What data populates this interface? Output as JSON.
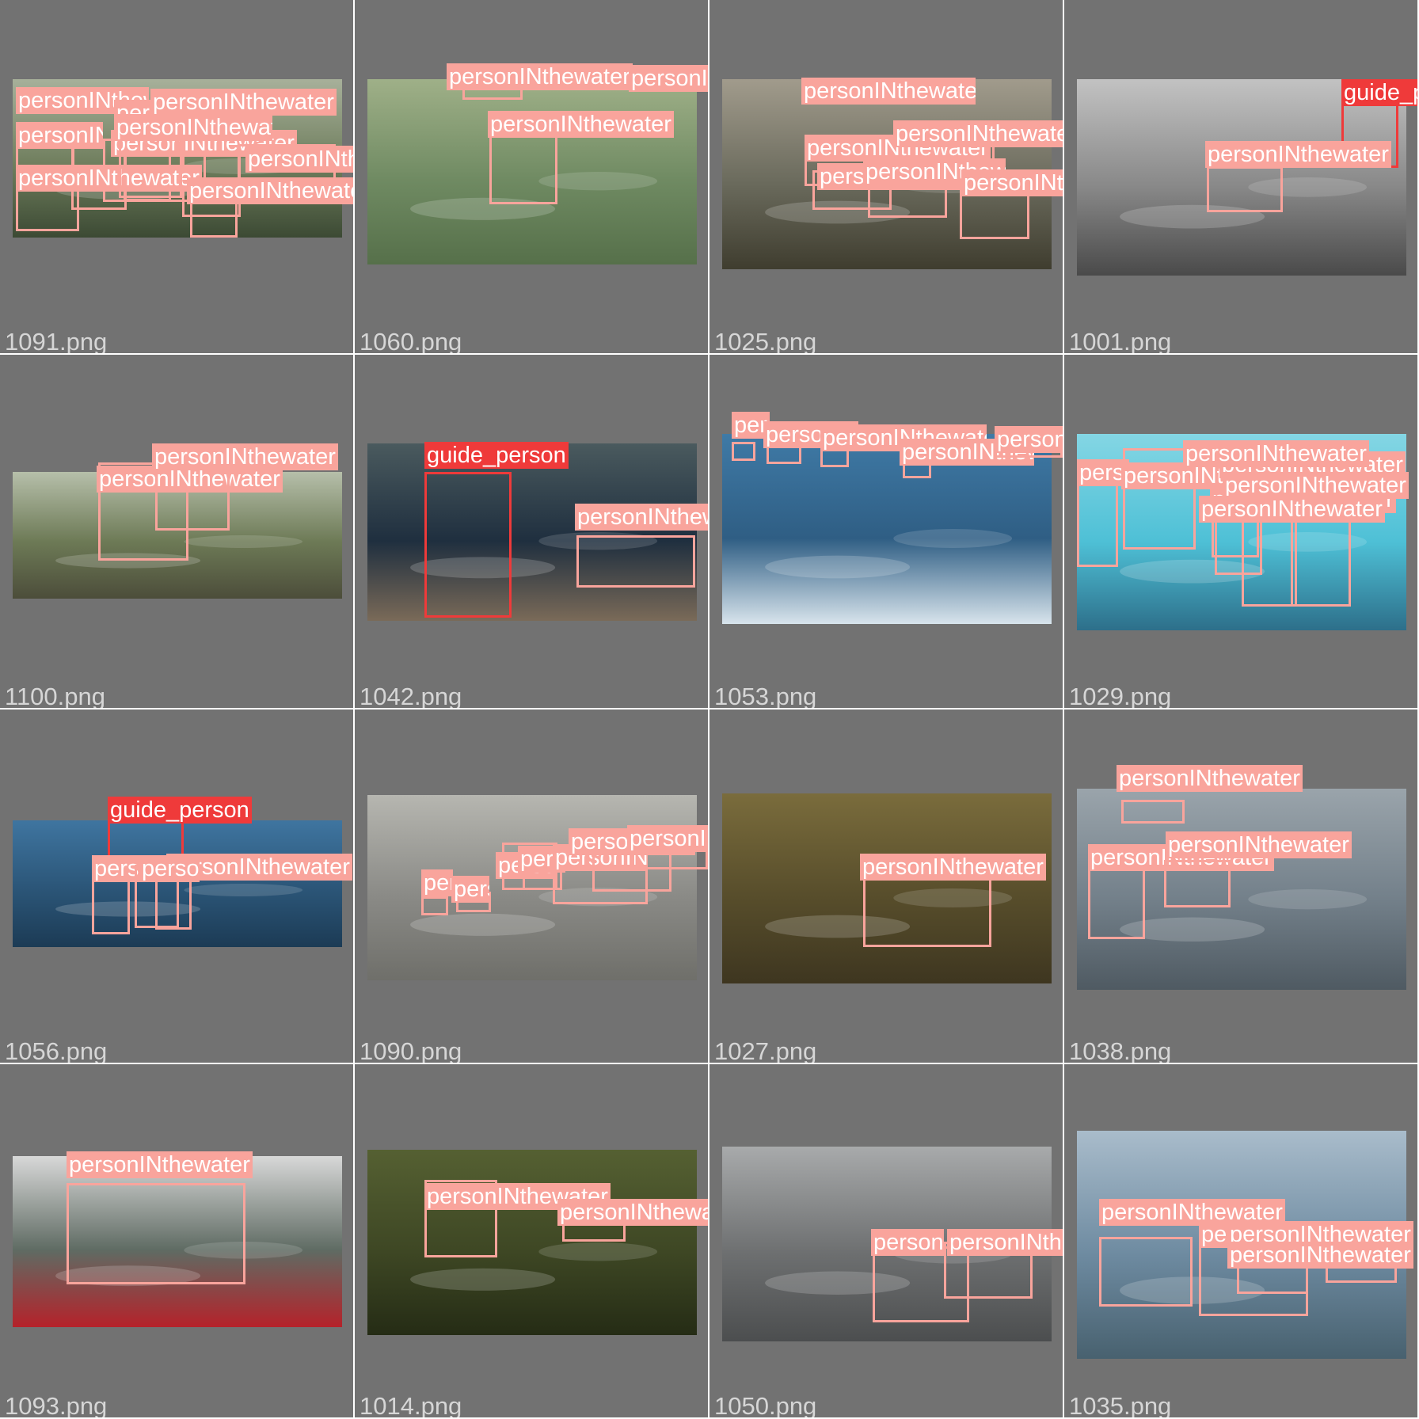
{
  "colors": {
    "tile_background": "#727272",
    "separator": "#ffffff",
    "personINthewater": "#f9a49c",
    "guide_person": "#ef3a3a",
    "filename_text": "#d6d6d6"
  },
  "tiles": [
    {
      "filename": "1091.png",
      "labels": [
        {
          "cls": "personINthewater",
          "text": "personINthewater"
        },
        {
          "cls": "personINthewater",
          "text": "personINthewater"
        },
        {
          "cls": "personINthewater",
          "text": "personINthewater"
        },
        {
          "cls": "personINthewater",
          "text": "personINthewater"
        },
        {
          "cls": "personINthewater",
          "text": "personINthewater"
        },
        {
          "cls": "personINthewater",
          "text": "personINthewater"
        },
        {
          "cls": "personINthewater",
          "text": "personINthewater"
        },
        {
          "cls": "personINthewater",
          "text": "personINthewater"
        },
        {
          "cls": "personINthewater",
          "text": "personINthewater"
        }
      ]
    },
    {
      "filename": "1060.png",
      "labels": [
        {
          "cls": "personINthewater",
          "text": "personINthewater"
        },
        {
          "cls": "personINthewater",
          "text": "personINthewater"
        },
        {
          "cls": "personINthewater",
          "text": "personINthewater"
        }
      ]
    },
    {
      "filename": "1025.png",
      "labels": [
        {
          "cls": "personINthewater",
          "text": "personINthewater"
        },
        {
          "cls": "personINthewater",
          "text": "personINthewater"
        },
        {
          "cls": "personINthewater",
          "text": "personINthewater"
        },
        {
          "cls": "personINthewater",
          "text": "personINthewater"
        },
        {
          "cls": "personINthewater",
          "text": "personINthewater"
        },
        {
          "cls": "personINthewater",
          "text": "personINthewater"
        }
      ]
    },
    {
      "filename": "1001.png",
      "labels": [
        {
          "cls": "guide_person",
          "text": "guide_person"
        },
        {
          "cls": "personINthewater",
          "text": "personINthewater"
        }
      ]
    },
    {
      "filename": "1100.png",
      "labels": [
        {
          "cls": "personINthewater",
          "text": "personINthewater"
        },
        {
          "cls": "personINthewater",
          "text": "personINthewater"
        }
      ]
    },
    {
      "filename": "1042.png",
      "labels": [
        {
          "cls": "guide_person",
          "text": "guide_person"
        },
        {
          "cls": "personINthewater",
          "text": "personINthewater"
        }
      ]
    },
    {
      "filename": "1053.png",
      "labels": [
        {
          "cls": "personINthewater",
          "text": "personINthewater"
        },
        {
          "cls": "personINthewater",
          "text": "personINthewater"
        },
        {
          "cls": "personINthewater",
          "text": "personINthewater"
        },
        {
          "cls": "personINthewater",
          "text": "personINthewater"
        },
        {
          "cls": "personINthewater",
          "text": "personINthewater"
        }
      ]
    },
    {
      "filename": "1029.png",
      "labels": [
        {
          "cls": "personINthewater",
          "text": "personINthewater"
        },
        {
          "cls": "personINthewater",
          "text": "personINthewater"
        },
        {
          "cls": "personINthewater",
          "text": "personINthewater"
        },
        {
          "cls": "personINthewater",
          "text": "personINthewater"
        },
        {
          "cls": "personINthewater",
          "text": "personINthewater"
        },
        {
          "cls": "personINthewater",
          "text": "personINthewater"
        },
        {
          "cls": "personINthewater",
          "text": "personINthewater"
        }
      ]
    },
    {
      "filename": "1056.png",
      "labels": [
        {
          "cls": "guide_person",
          "text": "guide_person"
        },
        {
          "cls": "personINthewater",
          "text": "personINthewater"
        },
        {
          "cls": "personINthewater",
          "text": "personINthewater"
        },
        {
          "cls": "personINthewater",
          "text": "personINthewater"
        }
      ]
    },
    {
      "filename": "1090.png",
      "labels": [
        {
          "cls": "personINthewater",
          "text": "personINthewater"
        },
        {
          "cls": "personINthewater",
          "text": "personINthewater"
        },
        {
          "cls": "personINthewater",
          "text": "personINthewater"
        },
        {
          "cls": "personINthewater",
          "text": "personINthewater"
        },
        {
          "cls": "personINthewater",
          "text": "personINthewater"
        },
        {
          "cls": "personINthewater",
          "text": "personINthewater"
        },
        {
          "cls": "personINthewater",
          "text": "personINthewater"
        }
      ]
    },
    {
      "filename": "1027.png",
      "labels": [
        {
          "cls": "personINthewater",
          "text": "personINthewater"
        }
      ]
    },
    {
      "filename": "1038.png",
      "labels": [
        {
          "cls": "personINthewater",
          "text": "personINthewater"
        },
        {
          "cls": "personINthewater",
          "text": "personINthewater"
        },
        {
          "cls": "personINthewater",
          "text": "personINthewater"
        }
      ]
    },
    {
      "filename": "1093.png",
      "labels": [
        {
          "cls": "personINthewater",
          "text": "personINthewater"
        }
      ]
    },
    {
      "filename": "1014.png",
      "labels": [
        {
          "cls": "personINthewater",
          "text": "personINthewater"
        },
        {
          "cls": "personINthewater",
          "text": "personINthewater"
        }
      ]
    },
    {
      "filename": "1050.png",
      "labels": [
        {
          "cls": "personINthewater",
          "text": "personINthewater"
        },
        {
          "cls": "personINthewater",
          "text": "personINthewater"
        }
      ]
    },
    {
      "filename": "1035.png",
      "labels": [
        {
          "cls": "personINthewater",
          "text": "personINthewater"
        },
        {
          "cls": "personINthewater",
          "text": "personINthewater"
        },
        {
          "cls": "personINthewater",
          "text": "personINthewater"
        },
        {
          "cls": "personINthewater",
          "text": "personINthewater"
        }
      ]
    }
  ]
}
